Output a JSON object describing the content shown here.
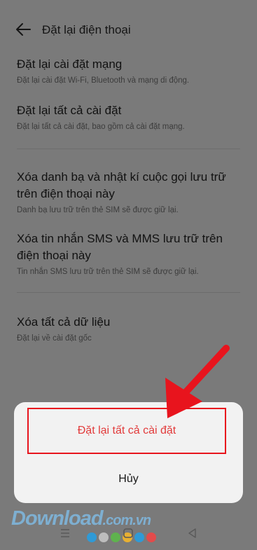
{
  "header": {
    "title": "Đặt lại điện thoại",
    "back_icon": "back-arrow-icon"
  },
  "items": [
    {
      "title": "Đặt lại cài đặt mạng",
      "subtitle": "Đặt lại cài đặt Wi-Fi, Bluetooth và mạng di động."
    },
    {
      "title": "Đặt lại tất cả cài đặt",
      "subtitle": "Đặt lại tất cả cài đặt, bao gồm cả cài đặt mạng."
    },
    {
      "title": "Xóa danh bạ và nhật kí cuộc gọi lưu trữ trên điện thoại này",
      "subtitle": "Danh bạ lưu trữ trên thẻ SIM sẽ được giữ lại."
    },
    {
      "title": "Xóa tin nhắn SMS và MMS lưu trữ trên điện thoại này",
      "subtitle": "Tin nhắn SMS lưu trữ trên thẻ SIM sẽ được giữ lại."
    },
    {
      "title": "Xóa tất cả dữ liệu",
      "subtitle": "Đặt lại về cài đặt gốc"
    }
  ],
  "dialog": {
    "confirm_label": "Đặt lại tất cả cài đặt",
    "cancel_label": "Hủy"
  },
  "watermark": {
    "main": "Download",
    "suffix": ".com.vn"
  },
  "colors": {
    "accent_red": "#e8141d",
    "confirm_text": "#e23b3b",
    "dim_overlay": "#7a7a7a",
    "dialog_bg": "#f2f2f2",
    "dots": [
      "#2f9ad6",
      "#bdbdbd",
      "#5fb24e",
      "#e8b032",
      "#2f9ad6",
      "#e24b4b"
    ]
  },
  "navbar": {
    "menu_icon": "menu-icon",
    "home_icon": "home-square-icon",
    "back_icon": "back-triangle-icon"
  }
}
